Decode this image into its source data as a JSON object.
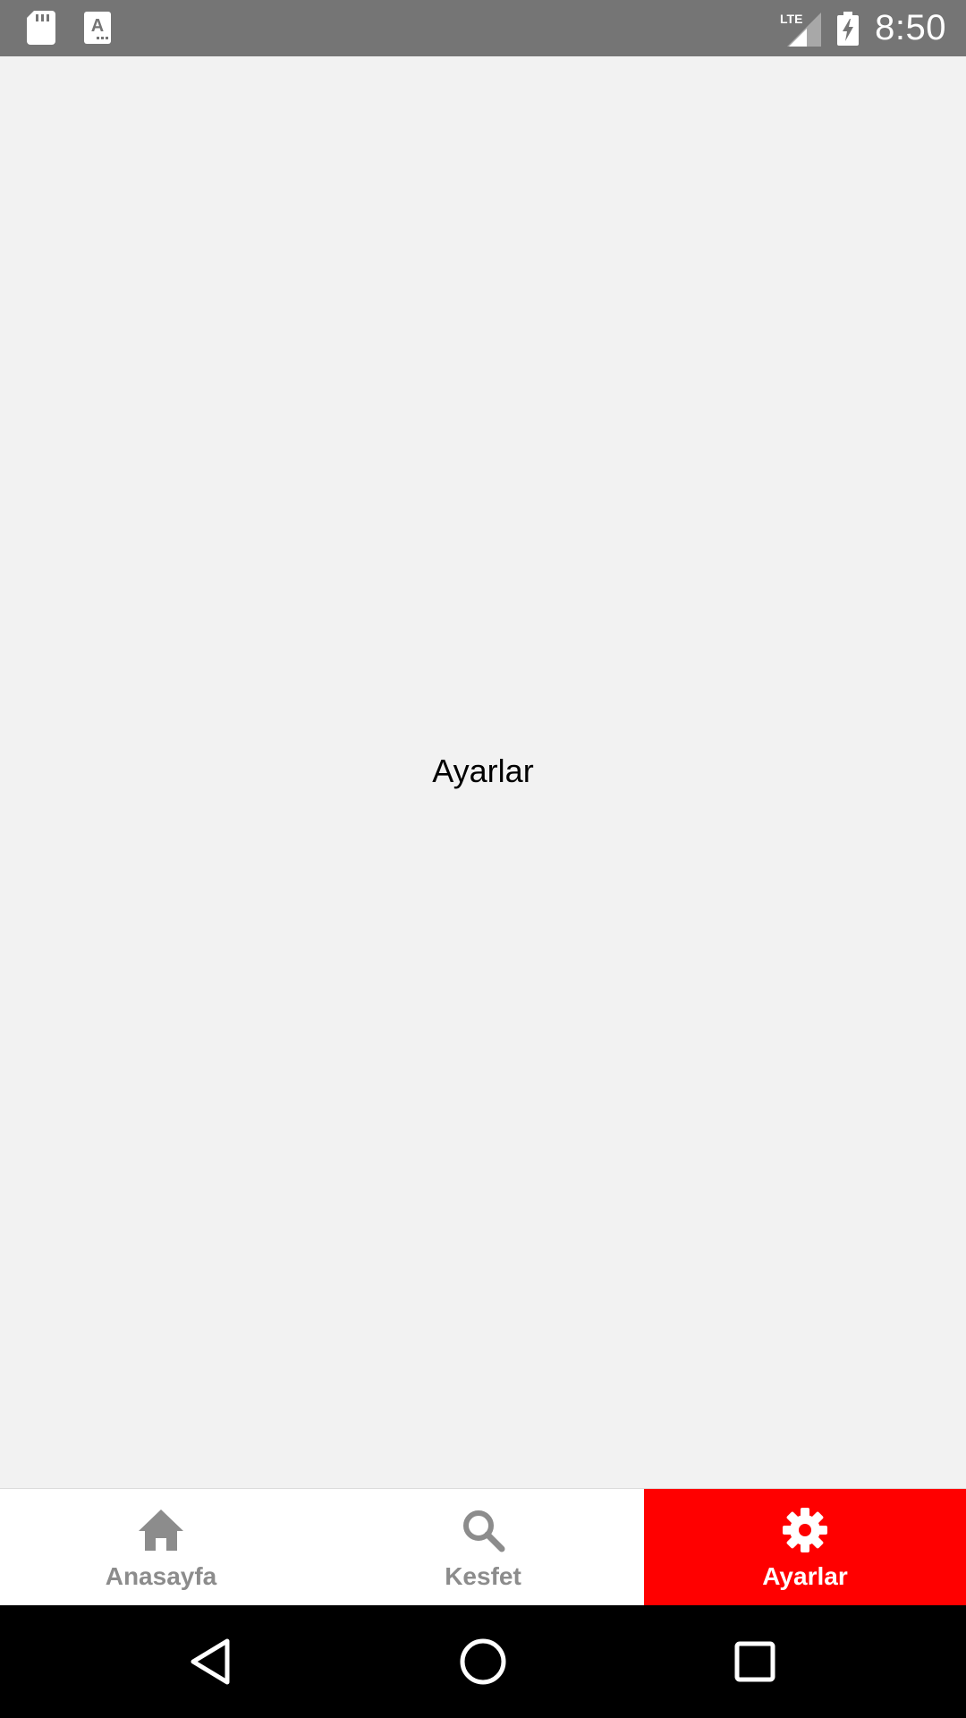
{
  "status_bar": {
    "time": "8:50",
    "network": "LTE",
    "icons": [
      "sd-card-icon",
      "text-a-icon",
      "lte-signal-icon",
      "battery-charging-icon"
    ]
  },
  "main": {
    "title": "Ayarlar"
  },
  "bottom_nav": {
    "items": [
      {
        "label": "Anasayfa",
        "icon": "home-icon",
        "active": false
      },
      {
        "label": "Kesfet",
        "icon": "search-icon",
        "active": false
      },
      {
        "label": "Ayarlar",
        "icon": "gear-icon",
        "active": true
      }
    ],
    "active_color": "#ff0000",
    "inactive_color": "#8c8c8c"
  },
  "system_nav": {
    "buttons": [
      "back-icon",
      "home-circle-icon",
      "recents-icon"
    ]
  }
}
